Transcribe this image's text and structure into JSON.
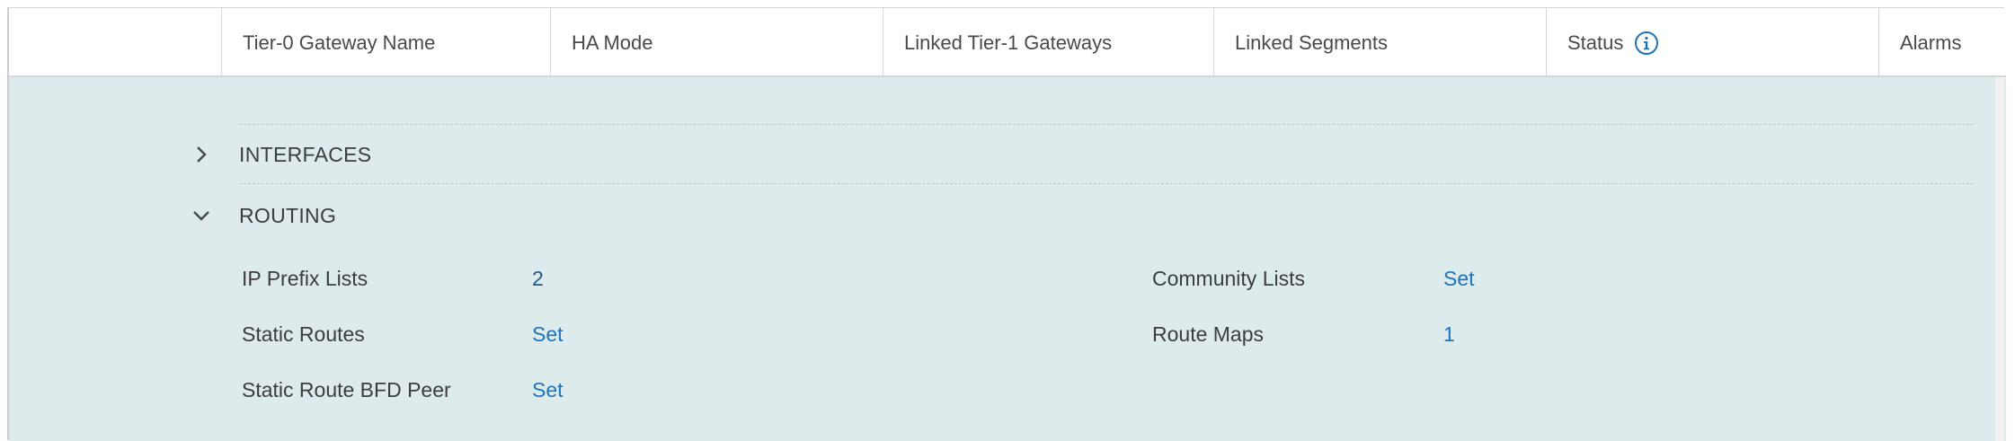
{
  "table": {
    "columns": [
      {
        "key": "name",
        "label": "Tier-0 Gateway Name"
      },
      {
        "key": "ha",
        "label": "HA Mode"
      },
      {
        "key": "t1",
        "label": "Linked Tier-1 Gateways"
      },
      {
        "key": "seg",
        "label": "Linked Segments"
      },
      {
        "key": "status",
        "label": "Status",
        "icon": "info-circle-icon"
      },
      {
        "key": "alarms",
        "label": "Alarms"
      }
    ]
  },
  "detail": {
    "interfaces_label": "INTERFACES",
    "routing_label": "ROUTING",
    "routing": {
      "ip_prefix_lists": {
        "label": "IP Prefix Lists",
        "value": "2"
      },
      "static_routes": {
        "label": "Static Routes",
        "value": "Set"
      },
      "static_route_bfd_peer": {
        "label": "Static Route BFD Peer",
        "value": "Set"
      },
      "community_lists": {
        "label": "Community Lists",
        "value": "Set"
      },
      "route_maps": {
        "label": "Route Maps",
        "value": "1"
      }
    }
  },
  "colors": {
    "panel_bg": "#deebec",
    "link": "#1f73b7",
    "header_border": "#d6d6d6"
  }
}
